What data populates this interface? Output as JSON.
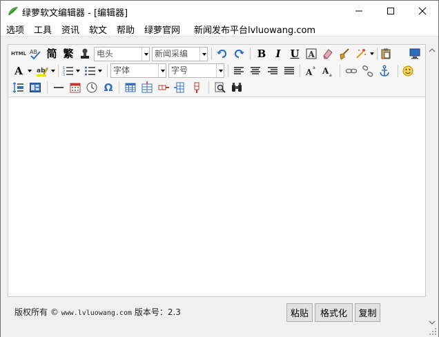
{
  "window": {
    "title": "绿萝软文编辑器 - [编辑器]"
  },
  "menu": {
    "items": [
      "选项",
      "工具",
      "资讯",
      "软文",
      "帮助",
      "绿萝官网",
      "新闻发布平台lvluowang.com"
    ]
  },
  "toolbar": {
    "html_label": "HTML",
    "simplified_label": "简",
    "traditional_label": "繁",
    "paragraph_combo_value": "电头",
    "template_combo_value": "新闻采编",
    "bold_label": "B",
    "italic_label": "I",
    "underline_label": "U",
    "font_color_label": "A",
    "font_combo_placeholder": "字体",
    "size_combo_placeholder": "字号",
    "special_char_label": "Ω"
  },
  "footer": {
    "copyright_prefix": "版权所有 © ",
    "copyright_url": "www.lvluowang.com",
    "version_label": " 版本号：2.3",
    "paste_button": "粘贴",
    "format_button": "格式化",
    "copy_button": "复制"
  },
  "colors": {
    "accent_blue": "#2f6fbf",
    "icon_red": "#c0392b",
    "logo_green": "#3a9b3a"
  }
}
